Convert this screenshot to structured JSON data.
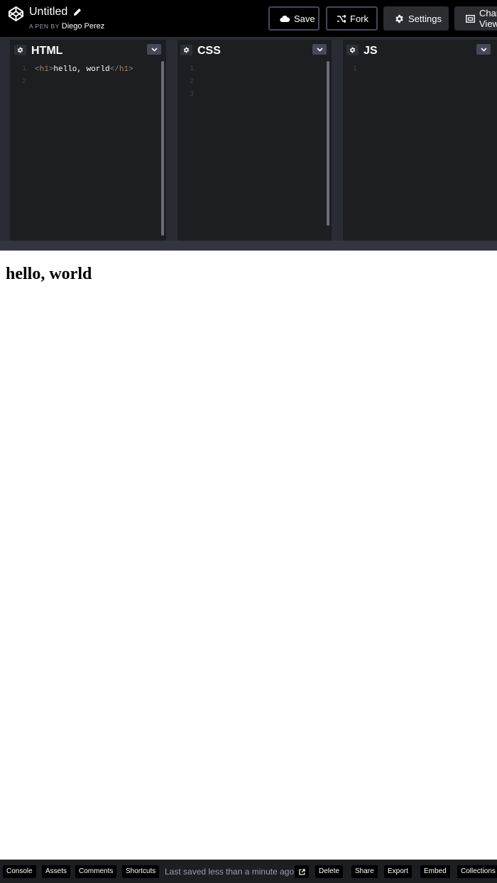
{
  "header": {
    "icons": {
      "logo": "codepen-logo-icon",
      "edit": "pencil-icon"
    },
    "title": "Untitled",
    "byline_prefix": "A PEN BY",
    "author": "Diego Perez",
    "buttons": [
      {
        "label": "Save",
        "icon": "cloud-icon"
      },
      {
        "label": "Fork",
        "icon": "fork-icon"
      },
      {
        "label": "Settings",
        "icon": "gear-icon"
      },
      {
        "label": "Change View",
        "icon": "layout-icon"
      }
    ]
  },
  "editors": [
    {
      "label": "HTML",
      "line_numbers": [
        "1",
        "2"
      ],
      "code": {
        "open_tag": "<h1>",
        "text": "hello, world",
        "close_tag": "</h1>"
      }
    },
    {
      "label": "CSS",
      "line_numbers": [
        "1",
        "2",
        "3"
      ]
    },
    {
      "label": "JS",
      "line_numbers": [
        "1"
      ]
    }
  ],
  "preview": {
    "heading": "hello, world"
  },
  "footer": {
    "left_buttons": [
      "Console",
      "Assets",
      "Comments",
      "Shortcuts"
    ],
    "status": "Last saved less than a minute ago",
    "open_icon": "external-link-icon",
    "right_buttons": [
      "Delete",
      "Share",
      "Export",
      "Embed",
      "Collections"
    ]
  },
  "colors": {
    "header_bg": "#000000",
    "editor_bg": "#1d1e22",
    "tag_color": "#9f876d",
    "footer_bg": "#1d1e22"
  }
}
